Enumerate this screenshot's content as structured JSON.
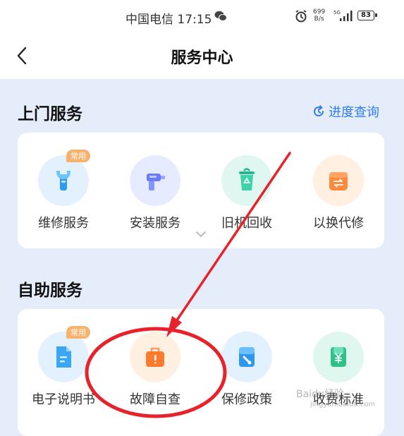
{
  "status_bar": {
    "carrier_time": "中国电信 17:15",
    "net_speed_value": "699",
    "net_speed_unit": "B/s",
    "network": "5G",
    "battery": "83"
  },
  "nav": {
    "title": "服务中心"
  },
  "home_service": {
    "title": "上门服务",
    "progress_link": "进度查询",
    "items": [
      {
        "label": "维修服务",
        "tag": "常用",
        "icon": "wrench-icon"
      },
      {
        "label": "安装服务",
        "icon": "drill-icon"
      },
      {
        "label": "旧机回收",
        "icon": "recycle-bin-icon"
      },
      {
        "label": "以换代修",
        "icon": "exchange-box-icon"
      }
    ]
  },
  "self_service": {
    "title": "自助服务",
    "items": [
      {
        "label": "电子说明书",
        "tag": "常用",
        "icon": "document-icon"
      },
      {
        "label": "故障自查",
        "icon": "toolbox-icon"
      },
      {
        "label": "保修政策",
        "icon": "repair-policy-icon"
      },
      {
        "label": "收费标准",
        "icon": "yuan-fee-icon"
      }
    ]
  },
  "watermark": {
    "text": "Baidu经验",
    "sub": "jingyan.baidu.com"
  },
  "colors": {
    "accent_blue": "#2f7cf6",
    "tag_orange": "#f7b26d",
    "annotation_red": "#e8222a",
    "page_bg": "#e6edfa"
  }
}
